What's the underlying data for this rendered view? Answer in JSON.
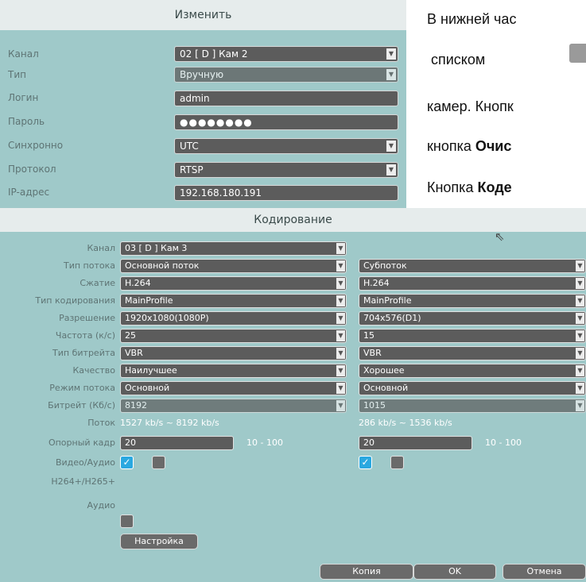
{
  "edit_dialog": {
    "title": "Изменить",
    "rows": [
      {
        "label": "Канал",
        "value": "02 [ D ] Кам 2",
        "dropdown": true
      },
      {
        "label": "Тип",
        "value": "Вручную",
        "dropdown": true
      },
      {
        "label": "Логин",
        "value": "admin",
        "dropdown": false
      },
      {
        "label": "Пароль",
        "value": "●●●●●●●●",
        "dropdown": false
      },
      {
        "label": "Синхронно",
        "value": "UTC",
        "dropdown": true
      },
      {
        "label": "Протокол",
        "value": "RTSP",
        "dropdown": true
      },
      {
        "label": "IP-адрес",
        "value": "192.168.180.191",
        "dropdown": false
      }
    ]
  },
  "right_text": {
    "line1": "В нижней час",
    "line2": "списком",
    "line3": "камер. Кнопк",
    "line4_prefix": "кнопка ",
    "line4_bold": "Очис",
    "line5_prefix": "Кнопка ",
    "line5_bold": "Коде"
  },
  "encoding_dialog": {
    "title": "Кодирование",
    "rows": [
      {
        "label": "Канал",
        "left": "03 [ D ] Кам 3",
        "right": null
      },
      {
        "label": "Тип потока",
        "left": "Основной поток",
        "right": "Субпоток"
      },
      {
        "label": "Сжатие",
        "left": "H.264",
        "right": "H.264"
      },
      {
        "label": "Тип кодирования",
        "left": "MainProfile",
        "right": "MainProfile"
      },
      {
        "label": "Разрешение",
        "left": "1920x1080(1080P)",
        "right": "704x576(D1)"
      },
      {
        "label": "Частота (к/с)",
        "left": "25",
        "right": "15"
      },
      {
        "label": "Тип битрейта",
        "left": "VBR",
        "right": "VBR"
      },
      {
        "label": "Качество",
        "left": "Наилучшее",
        "right": "Хорошее"
      },
      {
        "label": "Режим потока",
        "left": "Основной",
        "right": "Основной"
      },
      {
        "label": "Битрейт (Кб/с)",
        "left": "8192",
        "right": "1015"
      }
    ],
    "stream_label": "Поток",
    "stream_left": "1527 kb/s ~ 8192 kb/s",
    "stream_right": "286 kb/s ~ 1536 kb/s",
    "keyframe_label": "Опорный кадр",
    "keyframe_left": "20",
    "keyframe_left_range": "10 - 100",
    "keyframe_right": "20",
    "keyframe_right_range": "10 - 100",
    "video_audio_label": "Видео/Аудио",
    "video_left": true,
    "audio_left": false,
    "video_right": true,
    "audio_right": false,
    "h265_label": "H264+/H265+",
    "h265_enabled": false,
    "audio_label": "Аудио",
    "settings_button": "Настройка",
    "copy_button": "Копия",
    "ok_button": "OK",
    "cancel_button": "Отмена"
  }
}
